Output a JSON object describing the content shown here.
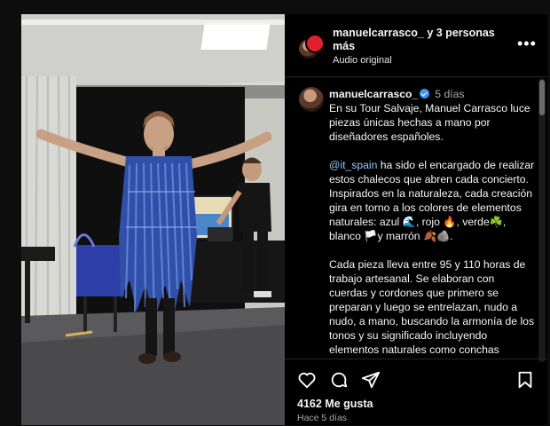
{
  "post": {
    "header": {
      "username": "manuelcarrasco_",
      "coauthors": "y 3 personas más",
      "audio": "Audio original",
      "more_icon": "more-horizontal-icon"
    },
    "caption": {
      "username": "manuelcarrasco_",
      "verified": true,
      "time": "5 días",
      "paragraph1": "En su Tour Salvaje, Manuel Carrasco luce piezas únicas hechas a mano por diseñadores españoles.",
      "mention": "@it_spain",
      "paragraph2": " ha sido el encargado de realizar estos chalecos que abren cada concierto. Inspirados en la naturaleza, cada creación gira en torno a los colores de elementos naturales: azul 🌊, rojo 🔥, verde☘️, blanco 🏳️y marrón 🍂🪨.",
      "paragraph3": "Cada pieza lleva entre 95 y 110 horas de trabajo artesanal. Se elaboran con cuerdas y cordones que primero se preparan y luego se entrelazan, nudo a nudo, a mano, buscando la armonía de los tonos y su significado incluyendo elementos naturales como conchas"
    },
    "actions": {
      "like_icon": "heart-icon",
      "comment_icon": "comment-icon",
      "share_icon": "send-icon",
      "save_icon": "bookmark-icon"
    },
    "likes": "4162 Me gusta",
    "posted": "Hace 5 días"
  },
  "colors": {
    "verified": "#3897f0",
    "mention": "#8fc7ff",
    "follow_badge": "#e0202a"
  }
}
